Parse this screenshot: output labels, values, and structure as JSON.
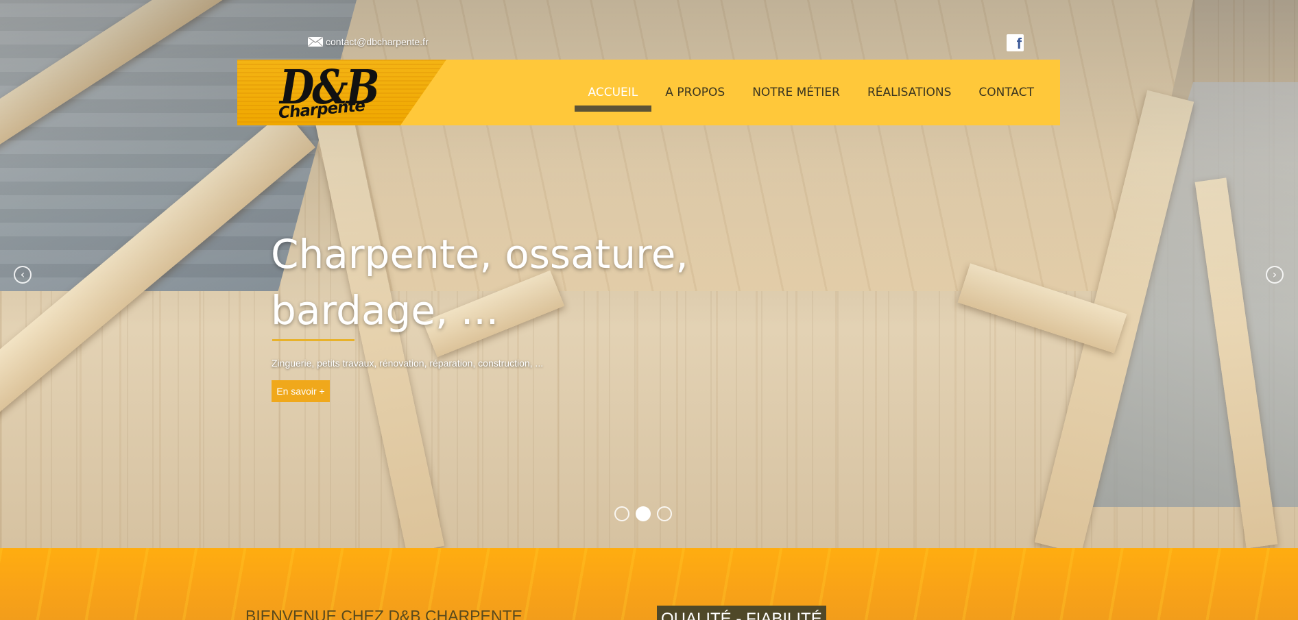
{
  "topbar": {
    "email": "contact@dbcharpente.fr",
    "email_icon": "envelope-icon",
    "facebook_icon": "facebook-icon",
    "facebook_glyph": "f"
  },
  "logo": {
    "main": "D&B",
    "sub": "Charpente"
  },
  "nav": {
    "items": [
      {
        "label": "ACCUEIL",
        "active": true
      },
      {
        "label": "A PROPOS"
      },
      {
        "label": "NOTRE MÉTIER"
      },
      {
        "label": "RÉALISATIONS"
      },
      {
        "label": "CONTACT"
      }
    ]
  },
  "hero": {
    "title_line1": "Charpente, ossature,",
    "title_line2": "bardage, ...",
    "subtitle": "Zinguerie, petits travaux, rénovation, réparation, construction, ...",
    "cta": "En savoir +",
    "prev_glyph": "‹",
    "next_glyph": "›",
    "slides_total": 3,
    "active_slide": 2
  },
  "welcome": {
    "title": "BIENVENUE CHEZ D&B CHARPENTE",
    "badge": "QUALITÉ - FIABILITÉ"
  },
  "colors": {
    "nav_bg": "#ffc83a",
    "accent": "#f0a81b",
    "active_underline": "#5c5336",
    "welcome_bg": "#f9a317"
  }
}
